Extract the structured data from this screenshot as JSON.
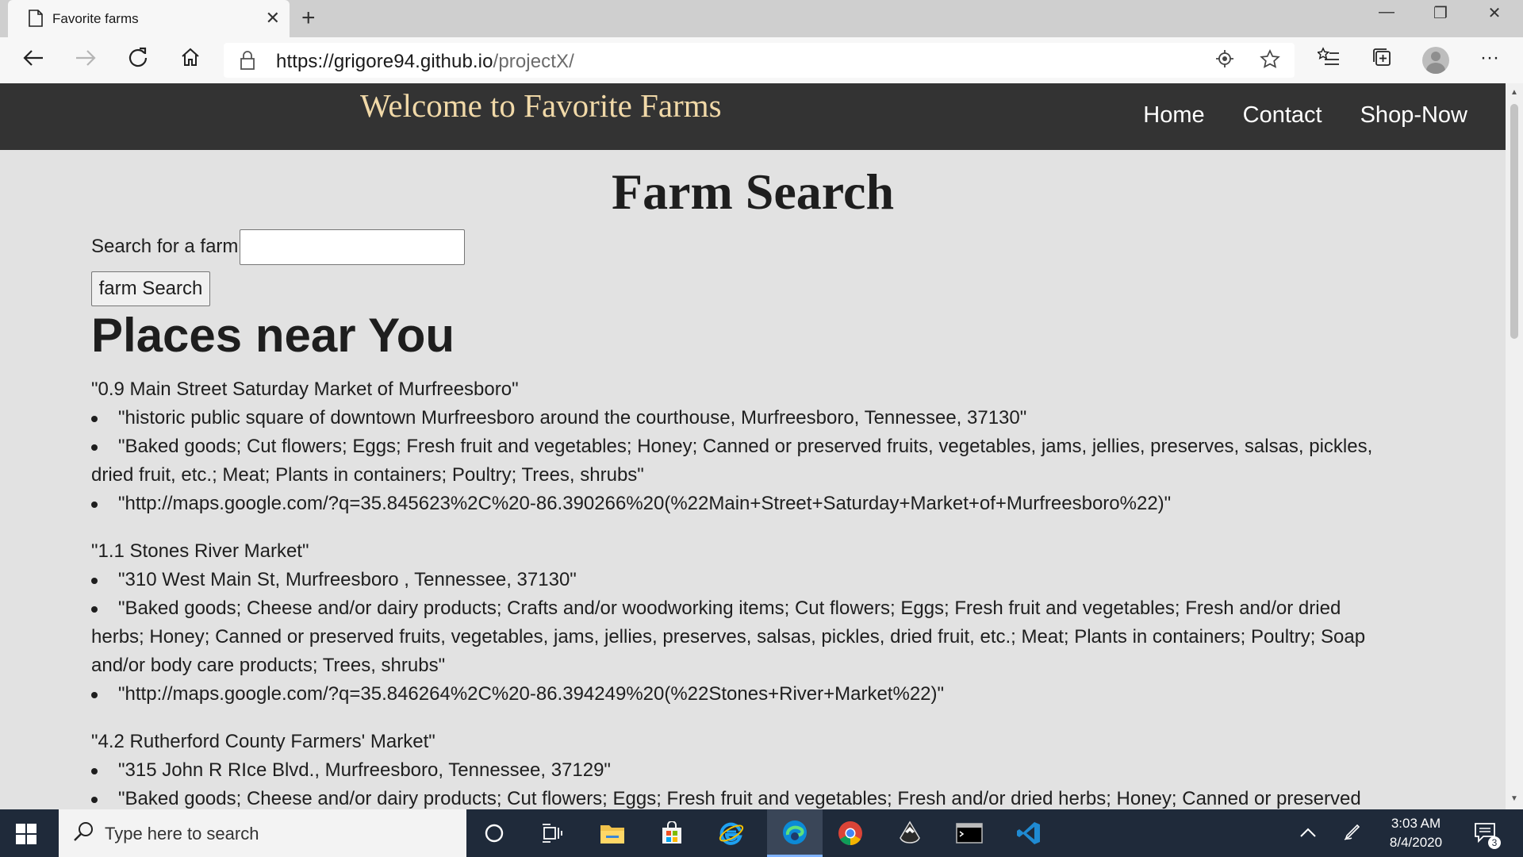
{
  "browser": {
    "tab_title": "Favorite farms",
    "tab_close": "✕",
    "new_tab": "+",
    "url_main": "https://grigore94.github.io",
    "url_path": "/projectX/",
    "window_controls": {
      "minimize": "—",
      "restore": "❐",
      "close": "✕"
    },
    "more": "···"
  },
  "site": {
    "title": "Welcome to Favorite Farms",
    "nav": [
      "Home",
      "Contact",
      "Shop-Now"
    ]
  },
  "main": {
    "heading": "Farm Search",
    "search_label": "Search for a farm",
    "search_value": "",
    "search_button": "farm Search",
    "places_heading": "Places near You",
    "listings": [
      {
        "name": "\"0.9 Main Street Saturday Market of Murfreesboro\"",
        "address": "\"historic public square of downtown Murfreesboro around the courthouse, Murfreesboro, Tennessee, 37130\"",
        "products": "\"Baked goods; Cut flowers; Eggs; Fresh fruit and vegetables; Honey; Canned or preserved fruits, vegetables, jams, jellies, preserves, salsas, pickles, dried fruit, etc.; Meat; Plants in containers; Poultry; Trees, shrubs\"",
        "link": "\"http://maps.google.com/?q=35.845623%2C%20-86.390266%20(%22Main+Street+Saturday+Market+of+Murfreesboro%22)\""
      },
      {
        "name": "\"1.1 Stones River Market\"",
        "address": "\"310 West Main St, Murfreesboro , Tennessee, 37130\"",
        "products": "\"Baked goods; Cheese and/or dairy products; Crafts and/or woodworking items; Cut flowers; Eggs; Fresh fruit and vegetables; Fresh and/or dried herbs; Honey; Canned or preserved fruits, vegetables, jams, jellies, preserves, salsas, pickles, dried fruit, etc.; Meat; Plants in containers; Poultry; Soap and/or body care products; Trees, shrubs\"",
        "link": "\"http://maps.google.com/?q=35.846264%2C%20-86.394249%20(%22Stones+River+Market%22)\""
      },
      {
        "name": "\"4.2 Rutherford County Farmers' Market\"",
        "address": "\"315 John R RIce Blvd., Murfreesboro, Tennessee, 37129\"",
        "products": "\"Baked goods; Cheese and/or dairy products; Cut flowers; Eggs; Fresh fruit and vegetables; Fresh and/or dried herbs; Honey; Canned or preserved fruits,"
      }
    ]
  },
  "taskbar": {
    "search_placeholder": "Type here to search",
    "time": "3:03 AM",
    "date": "8/4/2020",
    "notification_count": "3"
  }
}
